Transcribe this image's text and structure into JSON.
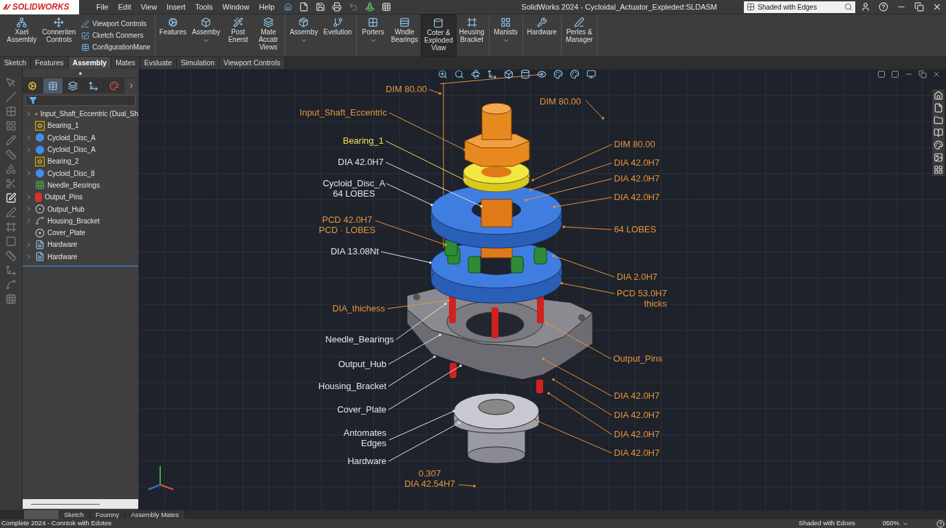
{
  "title_bar": {
    "logo": "SOLIDWORKS",
    "menu": [
      "File",
      "Edit",
      "View",
      "Insert",
      "Tools",
      "Window",
      "Help"
    ],
    "title": "SolidWorks 2024 - Cycloidal_Actuator_Expleded:SLDASM",
    "search": {
      "value": "Shaded with Edges"
    }
  },
  "command_manager": {
    "groups": [
      {
        "items": [
          {
            "kind": "large",
            "label": "Xael\nAssembly",
            "dropdown": false,
            "selected": false
          },
          {
            "kind": "large",
            "label": "Conneriten\nControls",
            "dropdown": false,
            "selected": false
          },
          {
            "kind": "stack",
            "items": [
              "Viewport Controls",
              "Cketch Conmers",
              "ConfigurationMane"
            ]
          }
        ]
      },
      {
        "items": [
          {
            "kind": "large",
            "label": "Features",
            "dropdown": false,
            "selected": false
          },
          {
            "kind": "large",
            "label": "Assemby",
            "dropdown": true,
            "selected": false
          },
          {
            "kind": "large",
            "label": "Post\nEnerst",
            "dropdown": false,
            "selected": false
          },
          {
            "kind": "large",
            "label": "Mate\nAccatr\nViews",
            "dropdown": false,
            "selected": false
          }
        ]
      },
      {
        "items": [
          {
            "kind": "large",
            "label": "Assemby",
            "dropdown": true,
            "selected": false
          },
          {
            "kind": "large",
            "label": "Evelution",
            "dropdown": false,
            "selected": false
          }
        ]
      },
      {
        "items": [
          {
            "kind": "large",
            "label": "Porters",
            "dropdown": true,
            "selected": false
          },
          {
            "kind": "large",
            "label": "Wndle\nBearings",
            "dropdown": false,
            "selected": false
          },
          {
            "kind": "large",
            "label": "Coter &\nExploded\nViaw",
            "dropdown": false,
            "selected": true
          },
          {
            "kind": "large",
            "label": "Heusing\nBracket",
            "dropdown": false,
            "selected": false
          }
        ]
      },
      {
        "items": [
          {
            "kind": "large",
            "label": "Manists",
            "dropdown": true,
            "selected": false
          }
        ]
      },
      {
        "items": [
          {
            "kind": "large",
            "label": "Hardware",
            "dropdown": false,
            "selected": false
          }
        ]
      },
      {
        "items": [
          {
            "kind": "large",
            "label": "Perles &\nManager",
            "dropdown": false,
            "selected": false
          }
        ]
      }
    ]
  },
  "tabs": [
    {
      "label": "Sketch",
      "selected": false
    },
    {
      "label": "Features",
      "selected": false
    },
    {
      "label": "Assembly",
      "selected": true
    },
    {
      "label": "Mates",
      "selected": false
    },
    {
      "label": "Evsluate",
      "selected": false
    },
    {
      "label": "Simulation",
      "selected": false
    },
    {
      "label": "Viewport Controls",
      "selected": false
    }
  ],
  "feature_tree": {
    "panel_tabs": [
      {
        "selected": false
      },
      {
        "selected": true
      },
      {
        "selected": false
      },
      {
        "selected": false
      },
      {
        "selected": false
      }
    ],
    "items": [
      {
        "label": "Input_Shaft_Eccentric (Dual_Sh",
        "kind": "assembly",
        "expandable": true
      },
      {
        "label": "Bearing_1",
        "kind": "bearing",
        "expandable": false
      },
      {
        "label": "Cycloid_Disc_A",
        "kind": "disc",
        "expandable": true
      },
      {
        "label": "Cycloid_Disc_A",
        "kind": "disc",
        "expandable": true
      },
      {
        "label": "Bearing_2",
        "kind": "bearing",
        "expandable": false
      },
      {
        "label": "Cycloid_Disc_8",
        "kind": "disc",
        "expandable": true
      },
      {
        "label": "Needle_Besrings",
        "kind": "needle",
        "expandable": false
      },
      {
        "label": "Output_Pins",
        "kind": "pin",
        "expandable": true
      },
      {
        "label": "Output_Hub",
        "kind": "hub",
        "expandable": true
      },
      {
        "label": "Housing_Bracket",
        "kind": "bracket",
        "expandable": true
      },
      {
        "label": "Cover_Plate",
        "kind": "plate",
        "expandable": false
      },
      {
        "label": "Hardware",
        "kind": "hardware",
        "expandable": true
      },
      {
        "label": "Hardware",
        "kind": "hardware",
        "expandable": true
      }
    ]
  },
  "viewport": {
    "annotations": [
      {
        "text": "DIM 80.00",
        "color": "#e8953a"
      },
      {
        "text": "Input_Shaft_Eccentric",
        "color": "#e8953a"
      },
      {
        "text": "Bearing_1",
        "color": "#f2e35a"
      },
      {
        "text": "DIA 42.0H7",
        "color": "#e6e6e6"
      },
      {
        "text": "Cycloid_Disc_A\n64 LOBES",
        "color": "#e6e6e6"
      },
      {
        "text": "PCD 42.0H7\nPCD · LOBES",
        "color": "#e8953a"
      },
      {
        "text": "DIA 13.08Nt",
        "color": "#e6e6e6"
      },
      {
        "text": "DIA_thichess",
        "color": "#e8953a"
      },
      {
        "text": "Needle_Bearings",
        "color": "#e6e6e6"
      },
      {
        "text": "Output_Hub",
        "color": "#e6e6e6"
      },
      {
        "text": "Housing_Bracket",
        "color": "#e6e6e6"
      },
      {
        "text": "Cover_Plate",
        "color": "#e6e6e6"
      },
      {
        "text": "Antomates\nEdges",
        "color": "#e6e6e6"
      },
      {
        "text": "Hardware",
        "color": "#e6e6e6"
      },
      {
        "text": "0.307\nDIA 42.54H7",
        "color": "#e8953a"
      },
      {
        "text": "DIM 80.00",
        "color": "#e8953a"
      },
      {
        "text": "DIM 80.00",
        "color": "#e8953a"
      },
      {
        "text": "DIA 42.0H7",
        "color": "#e8953a"
      },
      {
        "text": "DIA 42.0H7",
        "color": "#e8953a"
      },
      {
        "text": "DIA 42.0H7",
        "color": "#e8953a"
      },
      {
        "text": "64 LOBES",
        "color": "#e8953a"
      },
      {
        "text": "DIA 2.0H7",
        "color": "#e8953a"
      },
      {
        "text": "PCD 53.0H7\nthicks",
        "color": "#e8953a"
      },
      {
        "text": "Output_Pins",
        "color": "#e8953a"
      },
      {
        "text": "DIA 42.0H7",
        "color": "#e8953a"
      },
      {
        "text": "DIA 42.0H7",
        "color": "#e8953a"
      },
      {
        "text": "DIA 42.0H7",
        "color": "#e8953a"
      },
      {
        "text": "DIA 42.0H7",
        "color": "#e8953a"
      }
    ]
  },
  "bottom_tabs": [
    {
      "label": "Sketch",
      "selected": false
    },
    {
      "label": "Foumny",
      "selected": false
    },
    {
      "label": "Assembly Mates",
      "selected": false
    }
  ],
  "status_bar": {
    "message": "Complete 2024 - Conntok with Edotes",
    "display_mode": "Shaded with Edoes",
    "zoom": "050%"
  }
}
